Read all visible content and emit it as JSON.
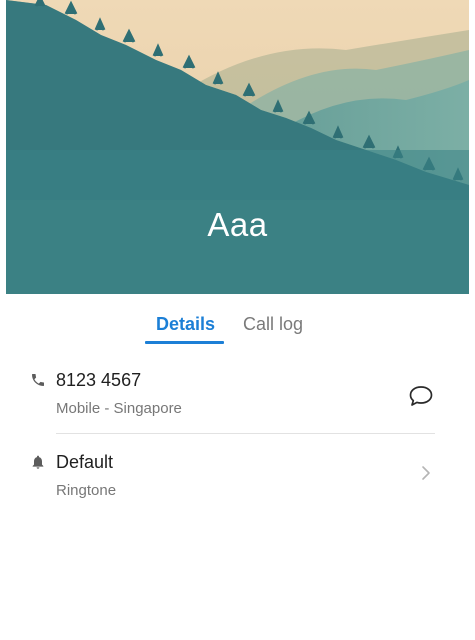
{
  "contact": {
    "name": "Aaa"
  },
  "tabs": [
    {
      "label": "Details"
    },
    {
      "label": "Call log"
    }
  ],
  "details": {
    "phone": {
      "number": "8123 4567",
      "type": "Mobile - Singapore"
    },
    "ringtone": {
      "value": "Default",
      "label": "Ringtone"
    }
  },
  "colors": {
    "accent": "#1c7fd6",
    "header_tint": "#3e8388"
  },
  "icons": {
    "phone": "phone-icon",
    "message": "message-icon",
    "bell": "bell-icon",
    "chevron": "chevron-right-icon"
  }
}
